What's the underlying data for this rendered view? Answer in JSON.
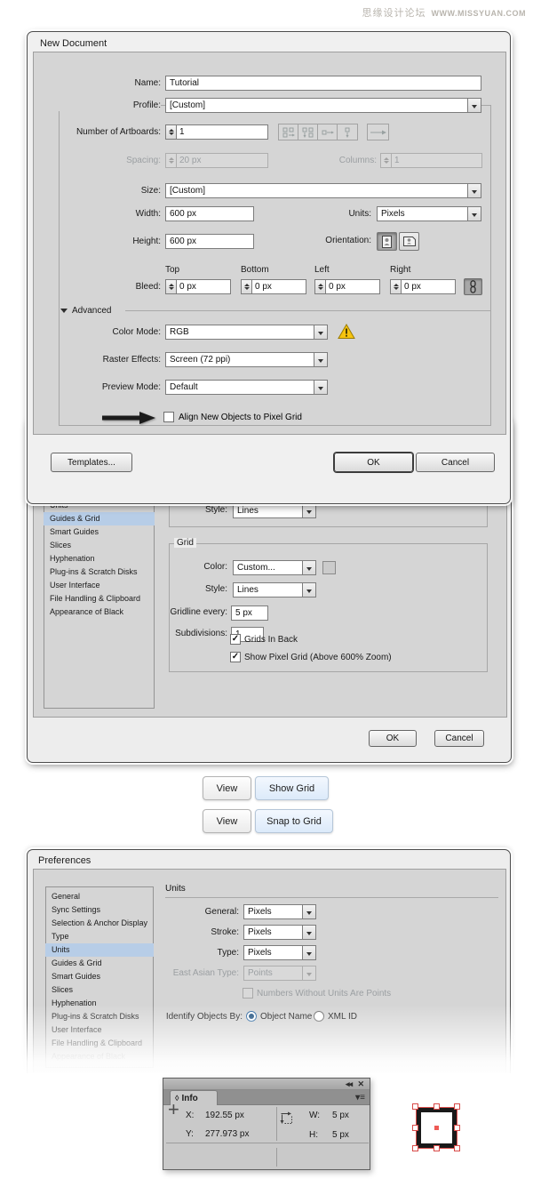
{
  "watermark": {
    "site_name": "思缘设计论坛",
    "site_url": "WWW.MISSYUAN.COM"
  },
  "icons": {
    "close": "✕",
    "collapse": "◂◂",
    "panel_menu": "▾≡",
    "cycle": "◊",
    "check": "✓",
    "crosshair": "+"
  },
  "new_document": {
    "title": "New Document",
    "fields": {
      "name": {
        "label": "Name:",
        "value": "Tutorial"
      },
      "profile": {
        "label": "Profile:",
        "value": "[Custom]"
      },
      "artboards": {
        "label": "Number of Artboards:",
        "value": "1"
      },
      "spacing": {
        "label": "Spacing:",
        "value": "20 px"
      },
      "columns": {
        "label": "Columns:",
        "value": "1"
      },
      "size": {
        "label": "Size:",
        "value": "[Custom]"
      },
      "width": {
        "label": "Width:",
        "value": "600 px"
      },
      "units": {
        "label": "Units:",
        "value": "Pixels"
      },
      "height": {
        "label": "Height:",
        "value": "600 px"
      },
      "orientation": {
        "label": "Orientation:"
      },
      "bleed": {
        "label": "Bleed:",
        "columns": [
          "Top",
          "Bottom",
          "Left",
          "Right"
        ],
        "values": [
          "0 px",
          "0 px",
          "0 px",
          "0 px"
        ]
      },
      "color_mode": {
        "label": "Color Mode:",
        "value": "RGB"
      },
      "raster_effects": {
        "label": "Raster Effects:",
        "value": "Screen (72 ppi)"
      },
      "preview_mode": {
        "label": "Preview Mode:",
        "value": "Default"
      }
    },
    "advanced_label": "Advanced",
    "pixel_grid_checkbox": "Align New Objects to Pixel Grid",
    "buttons": {
      "templates": "Templates...",
      "ok": "OK",
      "cancel": "Cancel"
    }
  },
  "guides_grid_prefs": {
    "sidebar": [
      "Units",
      "Guides & Grid",
      "Smart Guides",
      "Slices",
      "Hyphenation",
      "Plug-ins & Scratch Disks",
      "User Interface",
      "File Handling & Clipboard",
      "Appearance of Black"
    ],
    "guides": {
      "style_label": "Style:",
      "style_value": "Lines"
    },
    "grid": {
      "group_label": "Grid",
      "color_label": "Color:",
      "color_value": "Custom...",
      "style_label": "Style:",
      "style_value": "Lines",
      "gridline_label": "Gridline every:",
      "gridline_value": "5 px",
      "subdivisions_label": "Subdivisions:",
      "subdivisions_value": "1",
      "checkbox1": "Grids In Back",
      "checkbox2": "Show Pixel Grid (Above 600% Zoom)"
    },
    "buttons": {
      "ok": "OK",
      "cancel": "Cancel"
    }
  },
  "menu_buttons": {
    "rows": [
      {
        "menu": "View",
        "item": "Show Grid"
      },
      {
        "menu": "View",
        "item": "Snap to Grid"
      }
    ]
  },
  "units_prefs": {
    "title": "Preferences",
    "sidebar": [
      "General",
      "Sync Settings",
      "Selection & Anchor Display",
      "Type",
      "Units",
      "Guides & Grid",
      "Smart Guides",
      "Slices",
      "Hyphenation",
      "Plug-ins & Scratch Disks",
      "User Interface",
      "File Handling & Clipboard",
      "Appearance of Black"
    ],
    "section_title": "Units",
    "general_label": "General:",
    "general_value": "Pixels",
    "stroke_label": "Stroke:",
    "stroke_value": "Pixels",
    "type_label": "Type:",
    "type_value": "Pixels",
    "east_asian_label": "East Asian Type:",
    "east_asian_value": "Points",
    "numbers_checkbox": "Numbers Without Units Are Points",
    "identify_label": "Identify Objects By:",
    "radio_object_name": "Object Name",
    "radio_xml_id": "XML ID"
  },
  "info_panel": {
    "tab_label": "Info",
    "x_label": "X:",
    "x_value": "192.55 px",
    "y_label": "Y:",
    "y_value": "277.973 px",
    "w_label": "W:",
    "w_value": "5 px",
    "h_label": "H:",
    "h_value": "5 px"
  }
}
